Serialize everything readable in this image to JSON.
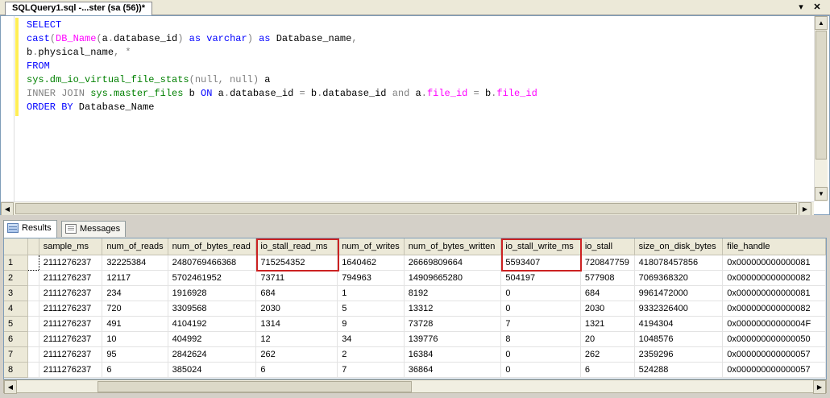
{
  "document_tab": {
    "title": "SQLQuery1.sql -...ster (sa (56))*",
    "dropdown_glyph": "▾",
    "close_glyph": "✕"
  },
  "query_lines": [
    [
      {
        "t": "SELECT",
        "c": "kw"
      }
    ],
    [
      {
        "t": "cast",
        "c": "kw"
      },
      {
        "t": "(",
        "c": "gr"
      },
      {
        "t": "DB_Name",
        "c": "fn"
      },
      {
        "t": "(",
        "c": "gr"
      },
      {
        "t": "a",
        "c": "pl"
      },
      {
        "t": ".",
        "c": "gr"
      },
      {
        "t": "database_id",
        "c": "pl"
      },
      {
        "t": ")",
        "c": "gr"
      },
      {
        "t": " as ",
        "c": "kw"
      },
      {
        "t": "varchar",
        "c": "kw"
      },
      {
        "t": ")",
        "c": "gr"
      },
      {
        "t": " as ",
        "c": "kw"
      },
      {
        "t": "Database_name",
        "c": "pl"
      },
      {
        "t": ",",
        "c": "gr"
      }
    ],
    [
      {
        "t": "b",
        "c": "pl"
      },
      {
        "t": ".",
        "c": "gr"
      },
      {
        "t": "physical_name",
        "c": "pl"
      },
      {
        "t": ", *",
        "c": "gr"
      }
    ],
    [
      {
        "t": "FROM",
        "c": "kw"
      }
    ],
    [
      {
        "t": "sys.dm_io_virtual_file_stats",
        "c": "sys"
      },
      {
        "t": "(null, null)",
        "c": "gr"
      },
      {
        "t": " a",
        "c": "pl"
      }
    ],
    [
      {
        "t": "INNER JOIN",
        "c": "gr"
      },
      {
        "t": " sys.master_files",
        "c": "sys"
      },
      {
        "t": " b ",
        "c": "pl"
      },
      {
        "t": "ON",
        "c": "kw"
      },
      {
        "t": " a",
        "c": "pl"
      },
      {
        "t": ".",
        "c": "gr"
      },
      {
        "t": "database_id ",
        "c": "pl"
      },
      {
        "t": "=",
        "c": "gr"
      },
      {
        "t": " b",
        "c": "pl"
      },
      {
        "t": ".",
        "c": "gr"
      },
      {
        "t": "database_id ",
        "c": "pl"
      },
      {
        "t": "and",
        "c": "gr"
      },
      {
        "t": " a",
        "c": "pl"
      },
      {
        "t": ".",
        "c": "gr"
      },
      {
        "t": "file_id",
        "c": "fn"
      },
      {
        "t": " = ",
        "c": "gr"
      },
      {
        "t": "b",
        "c": "pl"
      },
      {
        "t": ".",
        "c": "gr"
      },
      {
        "t": "file_id",
        "c": "fn"
      }
    ],
    [
      {
        "t": "ORDER BY",
        "c": "kw"
      },
      {
        "t": " Database_Name",
        "c": "pl"
      }
    ]
  ],
  "result_tabs": [
    {
      "label": "Results",
      "icon": "grid-icon",
      "active": true
    },
    {
      "label": "Messages",
      "icon": "messages-icon",
      "active": false
    }
  ],
  "grid": {
    "columns": [
      "",
      "sample_ms",
      "num_of_reads",
      "num_of_bytes_read",
      "io_stall_read_ms",
      "num_of_writes",
      "num_of_bytes_written",
      "io_stall_write_ms",
      "io_stall",
      "size_on_disk_bytes",
      "file_handle"
    ],
    "rows": [
      [
        "1",
        "",
        "2111276237",
        "32225384",
        "2480769466368",
        "715254352",
        "1640462",
        "26669809664",
        "5593407",
        "720847759",
        "418078457856",
        "0x000000000000081"
      ],
      [
        "2",
        "",
        "2111276237",
        "12117",
        "5702461952",
        "73711",
        "794963",
        "14909665280",
        "504197",
        "577908",
        "7069368320",
        "0x000000000000082"
      ],
      [
        "3",
        "",
        "2111276237",
        "234",
        "1916928",
        "684",
        "1",
        "8192",
        "0",
        "684",
        "9961472000",
        "0x000000000000081"
      ],
      [
        "4",
        "",
        "2111276237",
        "720",
        "3309568",
        "2030",
        "5",
        "13312",
        "0",
        "2030",
        "9332326400",
        "0x000000000000082"
      ],
      [
        "5",
        "",
        "2111276237",
        "491",
        "4104192",
        "1314",
        "9",
        "73728",
        "7",
        "1321",
        "4194304",
        "0x00000000000004F"
      ],
      [
        "6",
        "",
        "2111276237",
        "10",
        "404992",
        "12",
        "34",
        "139776",
        "8",
        "20",
        "1048576",
        "0x000000000000050"
      ],
      [
        "7",
        "",
        "2111276237",
        "95",
        "2842624",
        "262",
        "2",
        "16384",
        "0",
        "262",
        "2359296",
        "0x000000000000057"
      ],
      [
        "8",
        "",
        "2111276237",
        "6",
        "385024",
        "6",
        "7",
        "36864",
        "0",
        "6",
        "524288",
        "0x000000000000057"
      ]
    ],
    "highlighted_columns": [
      "io_stall_read_ms",
      "io_stall_write_ms"
    ],
    "highlight_color": "#cc2222"
  },
  "scroll": {
    "up": "▲",
    "down": "▼",
    "left": "◀",
    "right": "▶"
  }
}
